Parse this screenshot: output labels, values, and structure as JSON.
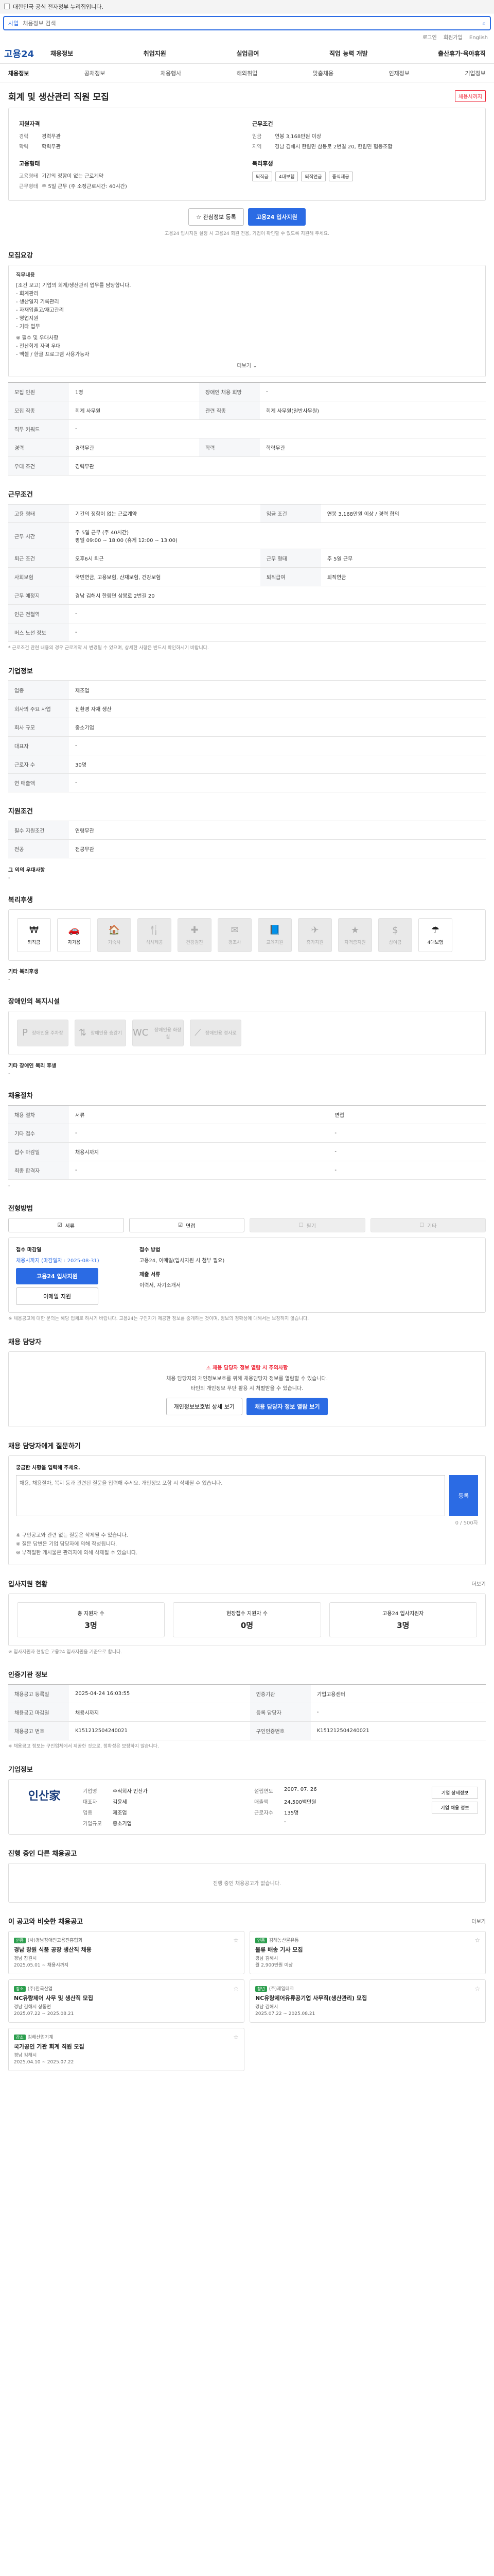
{
  "topbar": {
    "notice": "대한민국 공식 전자정부 누리집입니다."
  },
  "search": {
    "scope": "사업",
    "placeholder": "채용정보 검색"
  },
  "util": [
    "로그인",
    "회원가입",
    "English"
  ],
  "logo": "고용24",
  "gnb": [
    "채용정보",
    "취업지원",
    "실업급여",
    "직업 능력 개발",
    "출산휴가·육아휴직"
  ],
  "lnb": [
    "채용정보",
    "공채정보",
    "채용행사",
    "해외취업",
    "맞춤채용",
    "인재정보",
    "기업정보"
  ],
  "title": "회계 및 생산관리 직원 모집",
  "badge": "채용시까지",
  "summary": {
    "qual_title": "지원자격",
    "qual": [
      [
        "경력",
        "경력무관"
      ],
      [
        "학력",
        "학력무관"
      ]
    ],
    "cond_title": "근무조건",
    "cond": [
      [
        "임금",
        "연봉 3,168만원 이상"
      ],
      [
        "지역",
        "경남 김해시 한림면 삼봉로 2번길 20, 한림면 협동조합"
      ]
    ],
    "type_title": "고용형태",
    "type": [
      [
        "고용형태",
        "기간의 정함이 없는 근로계약"
      ],
      [
        "근무형태",
        "주 5일 근무 (주 소정근로시간: 40시간)"
      ]
    ],
    "welfare_title": "복리후생",
    "welfare": [
      "퇴직금",
      "4대보험",
      "퇴직연금",
      "중식제공"
    ]
  },
  "summary_btns": [
    "관심정보 등록",
    "고용24 입사지원"
  ],
  "summary_note": "고용24 입사지원 설정 시 고용24 회원 전용, 기업이 확인할 수 있도록 지원해 주세요.",
  "sec_job": "모집요강",
  "job_box": {
    "label": "직무내용",
    "lines": [
      "[조건 보고] 기업의 회계/생산관리 업무를 담당합니다.",
      "- 회계관리",
      "- 생산일지 기록관리",
      "- 자재입출고/재고관리",
      "- 영업지원",
      "- 기타 업무",
      "※ 필수 및 우대사항",
      "- 전산회계 자격 우대",
      "- 엑셀 / 한글 프로그램 사용가능자"
    ],
    "more": "더보기"
  },
  "job_table": [
    [
      "모집 인원",
      "1명",
      "장애인 채용 희망",
      "-"
    ],
    [
      "모집 직종",
      "회계 사무원",
      "관련 직종",
      "회계 사무원(일반사무원)"
    ],
    [
      "직무 키워드",
      "-",
      "",
      ""
    ],
    [
      "경력",
      "경력무관",
      "학력",
      "학력무관"
    ],
    [
      "우대 조건",
      "경력무관",
      "",
      ""
    ]
  ],
  "sec_cond": "근무조건",
  "cond_table": [
    [
      "고용 형태",
      "기간의 정함이 없는 근로계약",
      "임금 조건",
      "연봉 3,168만원 이상 / 경력 협의"
    ],
    [
      "근무 시간",
      "주 5일 근무 (주 40시간)\n평일 09:00 ~ 18:00 (휴게 12:00 ~ 13:00)",
      "",
      ""
    ],
    [
      "퇴근 조건",
      "오후6시 퇴근",
      "근무 형태",
      "주 5일 근무"
    ],
    [
      "사회보험",
      "국민연금, 고용보험, 산재보험, 건강보험",
      "퇴직급여",
      "퇴직연금"
    ],
    [
      "근무 예정지",
      "경남 김해시 한림면 삼봉로 2번길 20",
      "",
      ""
    ],
    [
      "인근 전철역",
      "-",
      "",
      ""
    ],
    [
      "버스 노선 정보",
      "-",
      "",
      ""
    ]
  ],
  "cond_note": "* 근로조건 관련 내용의 경우 근로계약 시 변경될 수 있으며, 상세한 사항은 반드시 확인하시기 바랍니다.",
  "sec_info": "기업정보",
  "info_table": [
    [
      "업종",
      "제조업"
    ],
    [
      "회사의 주요 사업",
      "친환경 자재 생산"
    ],
    [
      "회사 규모",
      "중소기업"
    ],
    [
      "대표자",
      "-"
    ],
    [
      "근로자 수",
      "30명"
    ],
    [
      "연 매출액",
      "-"
    ]
  ],
  "sec_req": "지원조건",
  "req_table": [
    [
      "필수 지원조건",
      "연령무관"
    ],
    [
      "전공",
      "전공무관"
    ]
  ],
  "req_extra_label": "그 외의 우대사항",
  "req_extra": "-",
  "sec_welfare": "복리후생",
  "welfare_icons": [
    {
      "n": "퇴직금",
      "on": true,
      "g": "₩"
    },
    {
      "n": "자가용",
      "on": true,
      "g": "🚗"
    },
    {
      "n": "기숙사",
      "on": false,
      "g": "🏠"
    },
    {
      "n": "식사제공",
      "on": false,
      "g": "🍴"
    },
    {
      "n": "건강검진",
      "on": false,
      "g": "✚"
    },
    {
      "n": "경조사",
      "on": false,
      "g": "✉"
    },
    {
      "n": "교육지원",
      "on": false,
      "g": "📘"
    },
    {
      "n": "휴가지원",
      "on": false,
      "g": "✈"
    },
    {
      "n": "자격증지원",
      "on": false,
      "g": "★"
    },
    {
      "n": "상여금",
      "on": false,
      "g": "$"
    },
    {
      "n": "4대보험",
      "on": true,
      "g": "☂"
    }
  ],
  "welfare_extra_label": "기타 복리후생",
  "welfare_extra": "-",
  "sec_disab": "장애인의 복지시설",
  "disab_icons": [
    {
      "n": "장애인용 주차장",
      "g": "P"
    },
    {
      "n": "장애인용 승강기",
      "g": "⇅"
    },
    {
      "n": "장애인용 화장실",
      "g": "WC"
    },
    {
      "n": "장애인용 경사로",
      "g": "⟋"
    }
  ],
  "disab_extra_label": "기타 장애인 복리 후생",
  "disab_extra": "-",
  "sec_apply_info": "채용절차",
  "apply_table": [
    [
      "채용 절차",
      "서류",
      "",
      "면접"
    ],
    [
      "기타 접수",
      "-",
      "",
      "-"
    ],
    [
      "접수 마감일",
      "채용시까지",
      "",
      "-"
    ],
    [
      "최종 합격자",
      "-",
      "",
      "-"
    ]
  ],
  "apply_note": "-",
  "sec_how": "전형방법",
  "how_opts": [
    {
      "n": "서류",
      "on": true
    },
    {
      "n": "면접",
      "on": true
    },
    {
      "n": "필기",
      "on": false
    },
    {
      "n": "기타",
      "on": false
    }
  ],
  "apply_box": {
    "t1": "접수 마감일",
    "v1": "채용시까지 (마감일자 : 2025-08-31)",
    "b1": "고용24 입사지원",
    "b2": "이메일 지원",
    "t2": "접수 방법",
    "v2": "고용24, 이메일(입사지원 시 첨부 필요)",
    "t3": "제출 서류",
    "v3": "이력서, 자기소개서"
  },
  "apply_foot": "※ 채용공고에 대한 문의는 해당 업체로 하시기 바랍니다. 고용24는 구인자가 제공한 정보를 중개하는 것이며, 정보의 정확성에 대해서는 보장하지 않습니다.",
  "sec_agent": "채용 담당자",
  "agent": {
    "warn": "채용 담당자 정보 열람 시 주의사항",
    "l1": "채용 담당자의 개인정보보호를 위해 채용담당자 정보를 열람할 수 있습니다.",
    "l2": "타인의 개인정보 무단 활용 시 처벌받을 수 있습니다.",
    "b1": "개인정보보호법 상세 보기",
    "b2": "채용 담당자 정보 열람 보기"
  },
  "sec_qa": "채용 담당자에게 질문하기",
  "qa": {
    "hint": "궁금한 사항을 입력해 주세요.",
    "placeholder": "채용, 채용절차, 복지 등과 관련된 질문을 입력해 주세요. 개인정보 포함 시 삭제될 수 있습니다.",
    "count": "0 / 500자",
    "reg": "등록",
    "list": [
      "※ 구인공고와 관련 없는 질문은 삭제될 수 있습니다.",
      "※ 질문 답변은 기업 담당자에 의해 작성됩니다.",
      "※ 부적절한 게시물은 관리자에 의해 삭제될 수 있습니다."
    ]
  },
  "sec_stats": "입사지원 현황",
  "stats": [
    {
      "k": "총 지원자 수",
      "v": "3명"
    },
    {
      "k": "현장접수 지원자 수",
      "v": "0명"
    },
    {
      "k": "고용24 입사지원자",
      "v": "3명"
    }
  ],
  "stats_more": "더보기",
  "stats_note": "※ 입사지원자 현황은 고용24 입사지원을 기준으로 합니다.",
  "sec_log": "인증기관 정보",
  "log_table": [
    [
      "채용공고 등록일",
      "2025-04-24 16:03:55",
      "인증기관",
      "기업고용센터"
    ],
    [
      "채용공고 마감일",
      "채용시까지",
      "등록 담당자",
      "-"
    ],
    [
      "채용공고 번호",
      "K151212504240021",
      "구인인증번호",
      "K151212504240021"
    ]
  ],
  "log_note": "※ 채용공고 정보는 구인업체에서 제공한 것으로, 정확성은 보장하지 않습니다.",
  "sec_company": "기업정보",
  "company": {
    "logo": "인산家",
    "name": "주식회사 인산가",
    "grid": [
      [
        "기업명",
        "주식회사 인산가"
      ],
      [
        "설립연도",
        "2007. 07. 26"
      ],
      [
        "대표자",
        "김윤세"
      ],
      [
        "매출액",
        "24,500백만원"
      ],
      [
        "업종",
        "제조업"
      ],
      [
        "근로자수",
        "135명"
      ],
      [
        "기업규모",
        "중소기업"
      ],
      [
        "",
        "-"
      ]
    ],
    "side": [
      "기업 상세정보",
      "기업 채용 정보"
    ]
  },
  "sec_same": "진행 중인 다른 채용공고",
  "same_empty": "진행 중인 채용공고가 없습니다.",
  "sec_rec": "이 공고와 비슷한 채용공고",
  "rec_more": "더보기",
  "rec_cards": [
    {
      "tag": "인증",
      "co": "(사)경남장애인고용진흥협회",
      "ti": "경남 창원 식품 공장 생산직 채용",
      "m1": "경남 창원시",
      "m2": "2025.05.01 ~ 채용시까지"
    },
    {
      "tag": "인증",
      "co": "김해농산물유통",
      "ti": "물류 배송 기사 모집",
      "m1": "경남 김해시",
      "m2": "월 2,900만원 이상"
    },
    {
      "tag": "강소",
      "co": "(주)한국산업",
      "ti": "NC유량제어 사무 및 생산직 모집",
      "m1": "경남 김해시 상동면",
      "m2": "2025.07.22 ~ 2025.08.21"
    },
    {
      "tag": "청년",
      "co": "(주)제일테크",
      "ti": "NC유량제어유류공기업 사무직(생산관리) 모집",
      "m1": "경남 김해시",
      "m2": "2025.07.22 ~ 2025.08.21"
    },
    {
      "tag": "강소",
      "co": "김해산업기계",
      "ti": "국가공인 기관 회계 직원 모집",
      "m1": "경남 김해시",
      "m2": "2025.04.10 ~ 2025.07.22"
    }
  ]
}
